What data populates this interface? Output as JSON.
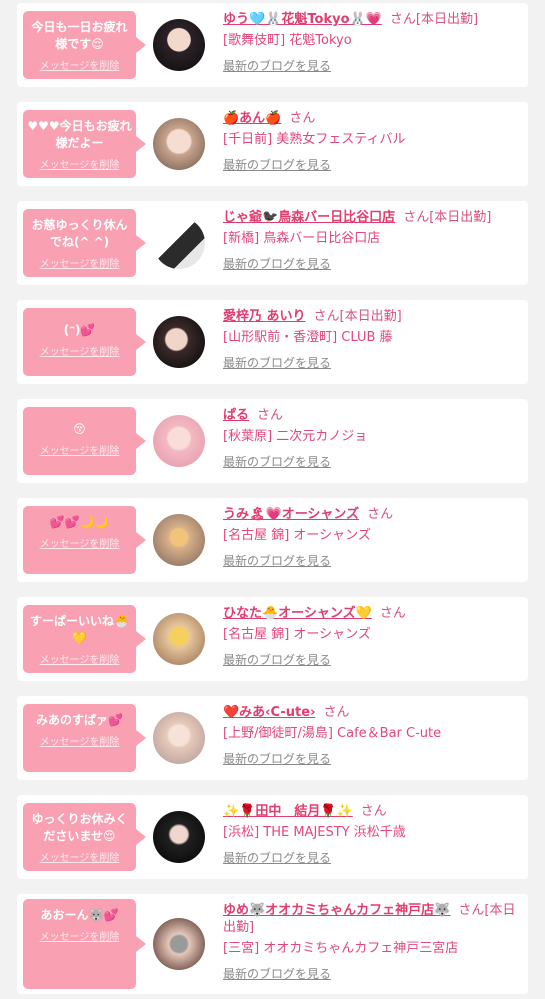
{
  "delete_label": "メッセージを削除",
  "blog_label": "最新のブログを見る",
  "honorific": "さん",
  "colors": {
    "bubble": "#f9a1b3",
    "name": "#e23d6e",
    "shop": "#e4477a",
    "link_gray": "#8a8a8a",
    "background": "#f2f2f2"
  },
  "messages": [
    {
      "message": "今日も一日お疲れ様です😌",
      "girl": "ゆう🩵🐰花魁Tokyo🐰💗",
      "status": "[本日出勤]",
      "shop": "[歌舞伎町] 花魁Tokyo",
      "avatar": "avatar-girl-dark-hair"
    },
    {
      "message": "♥♥♥今日もお疲れ様だよー",
      "girl": "🍎あん🍎",
      "status": "",
      "shop": "[千日前] 美熟女フェスティバル",
      "avatar": "avatar-girl-blurred-face"
    },
    {
      "message": "お慈ゆっくり休んでね(^ ^)",
      "girl": "じゃ爺🐦‍⬛鳥森バー日比谷口店",
      "status": "[本日出勤]",
      "shop": "[新橋] 鳥森バー日比谷口店",
      "avatar": "avatar-man-suit-logo"
    },
    {
      "message": "(ᵔ)💕",
      "girl": "愛梓乃 あいり",
      "status": "[本日出勤]",
      "shop": "[山形駅前・香澄町] CLUB 藤",
      "avatar": "avatar-girl-hand-face"
    },
    {
      "message": "😚",
      "girl": "ぱる",
      "status": "",
      "shop": "[秋葉原] 二次元カノジョ",
      "avatar": "avatar-girl-pink-hair"
    },
    {
      "message": "💕💕🌙🌙",
      "girl": "うみ🏝💗オーシャンズ",
      "status": "",
      "shop": "[名古屋 錦] オーシャンズ",
      "avatar": "avatar-girl-bear-sticker"
    },
    {
      "message": "すーぱーいいね🐣💛",
      "girl": "ひなた🐣オーシャンズ💛",
      "status": "",
      "shop": "[名古屋 錦] オーシャンズ",
      "avatar": "avatar-girl-yellow-sticker"
    },
    {
      "message": "みあのすぱァ💕",
      "girl": "❤️みあ‹C-ute›",
      "status": "",
      "shop": "[上野/御徒町/湯島] Cafe＆Bar C-ute",
      "avatar": "avatar-girl-light-hair"
    },
    {
      "message": "ゆっくりお休みくださいませ😌",
      "girl": "✨🌹田中　結月🌹✨",
      "status": "",
      "shop": "[浜松] THE MAJESTY 浜松千歳",
      "avatar": "avatar-girl-black-dress"
    },
    {
      "message": "あおーん🐺💕",
      "girl": "ゆめ🐺オオカミちゃんカフェ神戸店🐺",
      "status": "[本日出勤]",
      "shop": "[三宮] オオカミちゃんカフェ神戸三宮店",
      "avatar": "avatar-girl-gray-sticker"
    }
  ]
}
